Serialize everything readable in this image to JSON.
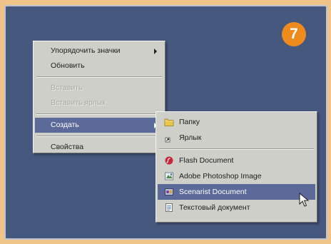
{
  "badge": "7",
  "context_menu": {
    "items": [
      {
        "label": "Упорядочить значки",
        "has_submenu": true,
        "disabled": false
      },
      {
        "label": "Обновить",
        "disabled": false
      },
      {
        "label": "Вставить",
        "disabled": true
      },
      {
        "label": "Вставить ярлык",
        "disabled": true
      },
      {
        "label": "Создать",
        "has_submenu": true,
        "active": true
      },
      {
        "label": "Свойства",
        "disabled": false
      }
    ]
  },
  "submenu": {
    "items": [
      {
        "label": "Папку",
        "icon": "folder-icon"
      },
      {
        "label": "Ярлык",
        "icon": "shortcut-icon"
      },
      {
        "label": "Flash Document",
        "icon": "flash-document-icon"
      },
      {
        "label": "Adobe Photoshop Image",
        "icon": "photoshop-image-icon"
      },
      {
        "label": "Scenarist Document",
        "icon": "scenarist-document-icon",
        "active": true
      },
      {
        "label": "Текстовый документ",
        "icon": "text-document-icon"
      }
    ]
  },
  "colors": {
    "desktop": "#46587e",
    "menu": "#cfcfc9",
    "highlight": "#5b6a99",
    "badge": "#ef8a1d",
    "frame": "#f0c488"
  }
}
